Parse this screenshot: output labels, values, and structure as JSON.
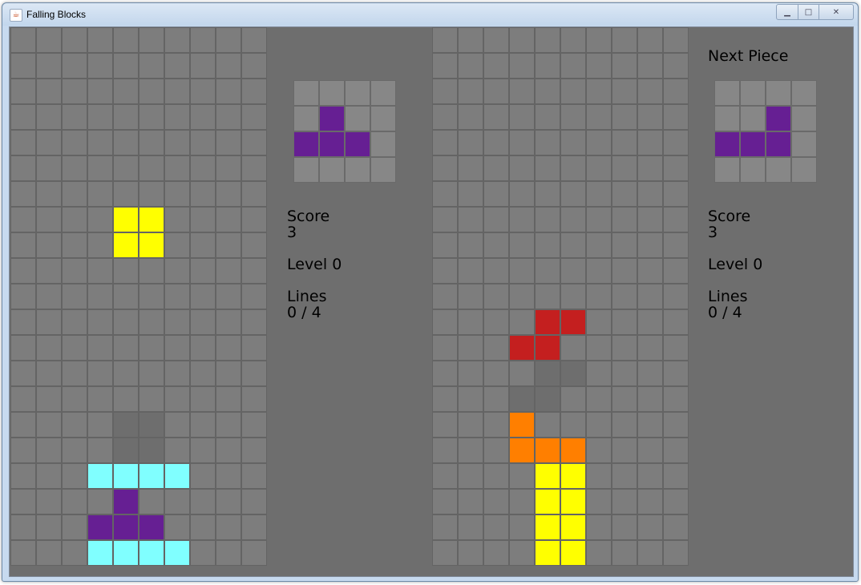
{
  "window": {
    "title": "Falling Blocks",
    "controls": [
      "minimize",
      "maximize",
      "close"
    ]
  },
  "colors": {
    "empty": "#7d7d7d",
    "ghost": "#6e6e6e",
    "I": "#80ffff",
    "T": "#661f93",
    "O": "#ffff00",
    "Z": "#c41f1f",
    "L": "#ff7f00",
    "preview_empty": "#878787"
  },
  "player1": {
    "board": [
      "..........",
      "..........",
      "..........",
      "..........",
      "..........",
      "..........",
      "..........",
      "....OO....",
      "....OO....",
      "..........",
      "..........",
      "..........",
      "..........",
      "..........",
      "..........",
      "....gg....",
      "....gg....",
      "...IIII...",
      "....T.....",
      "...TTT....",
      "...IIII..."
    ],
    "next_piece": [
      "....",
      ".T..",
      "TTT.",
      "...."
    ],
    "score_label": "Score",
    "score": "3",
    "level": "Level 0",
    "lines_label": "Lines",
    "lines": "0 / 4"
  },
  "player2": {
    "board": [
      "..........",
      "..........",
      "..........",
      "..........",
      "..........",
      "..........",
      "..........",
      "..........",
      "..........",
      "..........",
      "..........",
      "....ZZ....",
      "...ZZ.....",
      "....gg....",
      "...gg.....",
      "...L......",
      "...LLL....",
      "....OO....",
      "....OO....",
      "....OO....",
      "....OO...."
    ],
    "next_label": "Next Piece",
    "next_piece": [
      "....",
      "..T.",
      ".TTT.",
      "...."
    ],
    "score_label": "Score",
    "score": "3",
    "level": "Level 0",
    "lines_label": "Lines",
    "lines": "0 / 4"
  }
}
